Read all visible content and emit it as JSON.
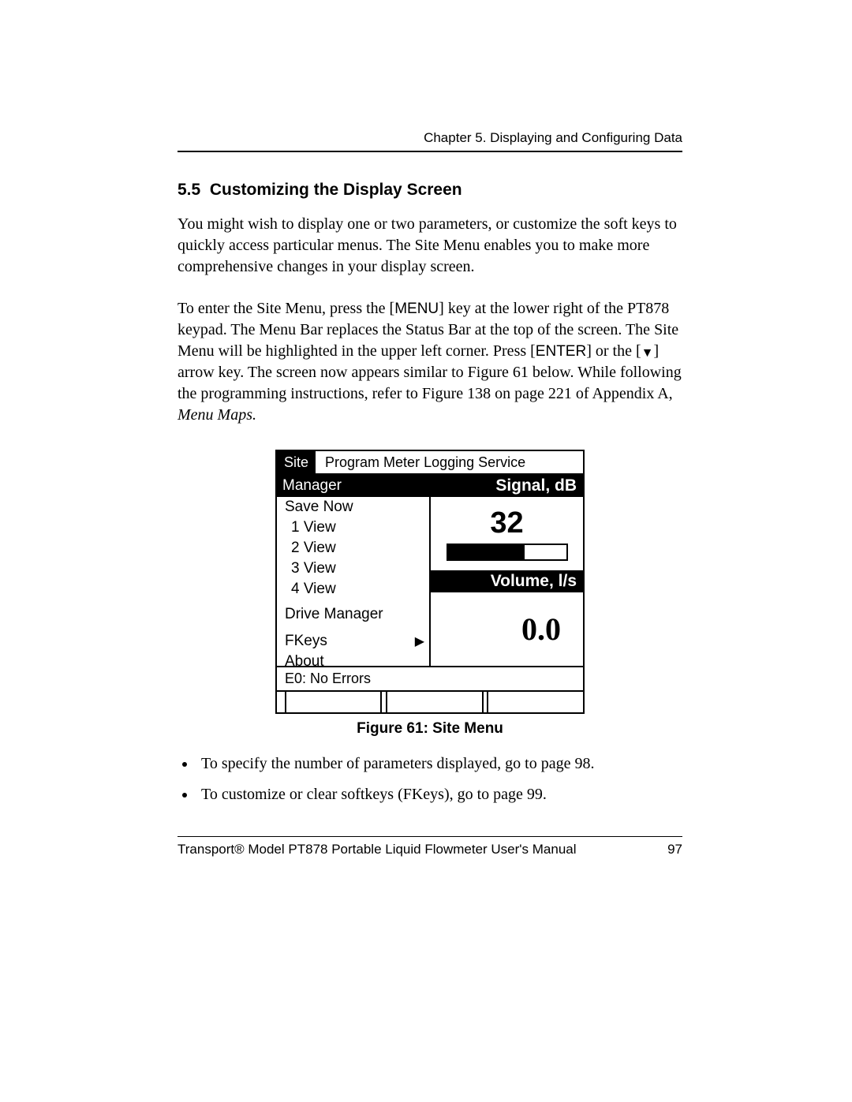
{
  "header": {
    "running_head": "Chapter 5. Displaying and Configuring Data"
  },
  "section": {
    "number": "5.5",
    "title": "Customizing the Display Screen"
  },
  "paragraphs": {
    "p1": "You might wish to display one or two parameters, or customize the soft keys to quickly access particular menus. The Site Menu enables you to make more comprehensive changes in your display screen.",
    "p2_a": "To enter the Site Menu, press the [",
    "p2_menu": "MENU",
    "p2_b": "] key at the lower right of the PT878 keypad. The Menu Bar replaces the Status Bar at the top of the screen. The Site Menu will be highlighted in the upper left corner. Press [",
    "p2_enter": "ENTER",
    "p2_c": "] or the [",
    "p2_d": "] arrow key. The screen now appears similar to Figure 61 below. While following the programming instructions, refer to Figure 138 on page 221 of Appendix A, ",
    "p2_ital": "Menu Maps.",
    "down_triangle": "▼"
  },
  "figure": {
    "caption": "Figure 61: Site Menu",
    "menu_tabs": {
      "site": "Site",
      "rest": "Program    Meter  Logging  Service"
    },
    "left_menu": {
      "manager": "Manager",
      "save_now": "Save Now",
      "views": [
        "1 View",
        "2 View",
        "3 View",
        "4 View"
      ],
      "drive_manager": "Drive Manager",
      "fkeys": "FKeys",
      "about": "About"
    },
    "right_panel": {
      "signal_label": "Signal, dB",
      "signal_value": "32",
      "signal_progress_pct": 65,
      "volume_label": "Volume, l/s",
      "volume_value": "0.0"
    },
    "status": "E0: No Errors"
  },
  "bullets": [
    "To specify the number of parameters displayed, go to page 98.",
    "To customize or clear softkeys (FKeys), go to page 99."
  ],
  "footer": {
    "title": "Transport® Model PT878 Portable Liquid Flowmeter User's Manual",
    "page": "97"
  }
}
